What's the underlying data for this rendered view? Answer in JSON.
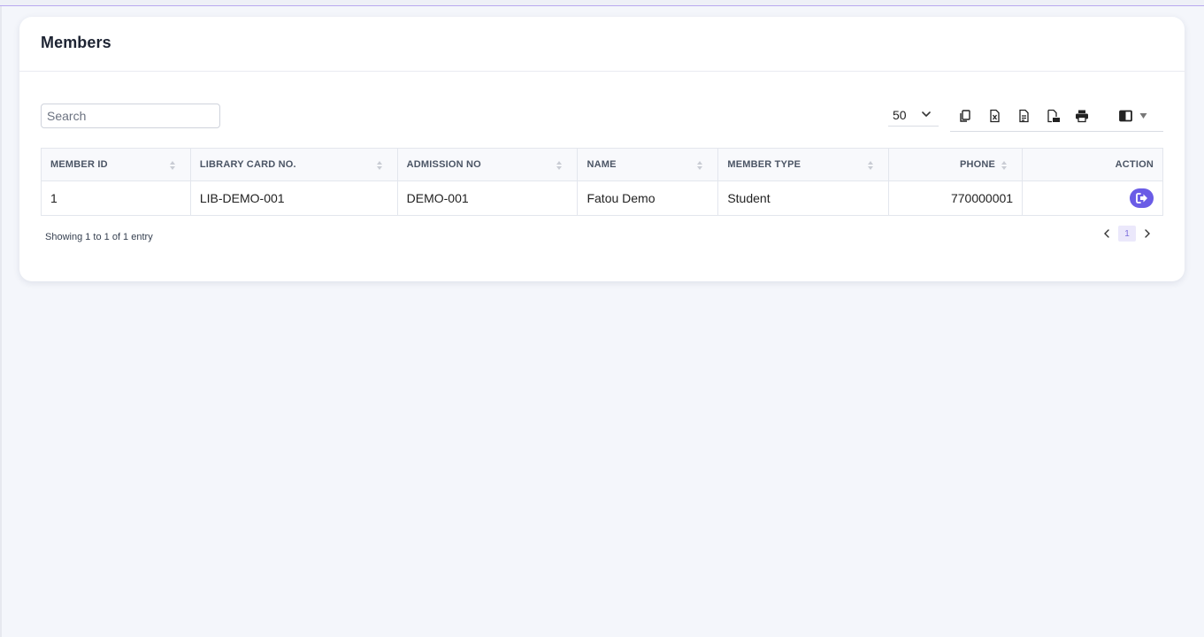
{
  "card": {
    "title": "Members"
  },
  "search": {
    "placeholder": "Search"
  },
  "page_length": {
    "value": "50"
  },
  "export_buttons": [
    {
      "icon": "copy-icon"
    },
    {
      "icon": "excel-icon"
    },
    {
      "icon": "csv-icon"
    },
    {
      "icon": "pdf-icon"
    },
    {
      "icon": "print-icon"
    }
  ],
  "table": {
    "columns": [
      "MEMBER ID",
      "LIBRARY CARD NO.",
      "ADMISSION NO",
      "NAME",
      "MEMBER TYPE",
      "PHONE",
      "ACTION"
    ],
    "rows": [
      {
        "member_id": "1",
        "library_card_no": "LIB-DEMO-001",
        "admission_no": "DEMO-001",
        "name": "Fatou Demo",
        "member_type": "Student",
        "phone": "770000001"
      }
    ]
  },
  "info": {
    "text": "Showing 1 to 1 of 1 entry"
  },
  "pagination": {
    "current_page": "1"
  },
  "colors": {
    "accent": "#6a5ce6",
    "background": "#f4f6fb",
    "card": "#ffffff"
  }
}
